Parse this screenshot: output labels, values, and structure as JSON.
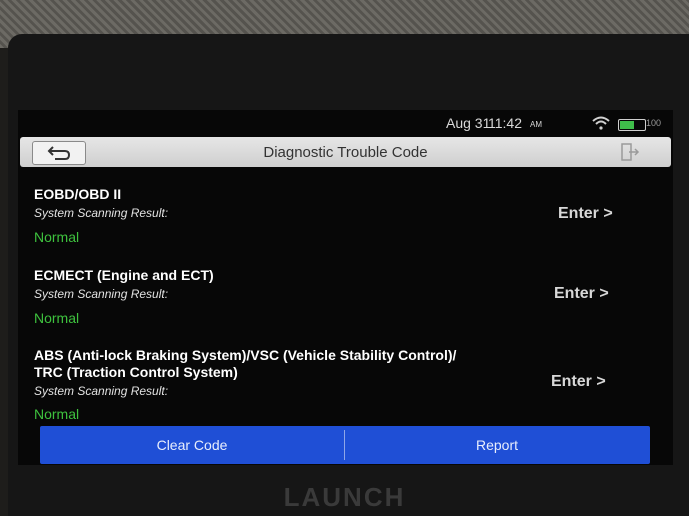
{
  "status_bar": {
    "date": "Aug 31",
    "time": "11:42",
    "ampm": "AM",
    "battery_label": "100",
    "icons": [
      "wifi-icon",
      "battery-icon"
    ]
  },
  "header": {
    "title": "Diagnostic Trouble Code",
    "back_icon": "back-arrow-icon",
    "exit_icon": "exit-icon"
  },
  "systems": [
    {
      "name": "EOBD/OBD II",
      "scan_label": "System Scanning Result:",
      "result": "Normal",
      "action": "Enter >"
    },
    {
      "name": "ECMECT (Engine and ECT)",
      "scan_label": "System Scanning Result:",
      "result": "Normal",
      "action": "Enter >"
    },
    {
      "name": "ABS (Anti-lock Braking System)/VSC (Vehicle Stability Control)/\nTRC (Traction Control System)",
      "scan_label": "System Scanning Result:",
      "result": "Normal",
      "action": "Enter >"
    }
  ],
  "footer": {
    "clear_code_label": "Clear Code",
    "report_label": "Report"
  },
  "device": {
    "brand": "LAUNCH"
  },
  "colors": {
    "accent_blue": "#1f4fd6",
    "status_green": "#3ec23e",
    "battery_green": "#3fbe4a"
  }
}
